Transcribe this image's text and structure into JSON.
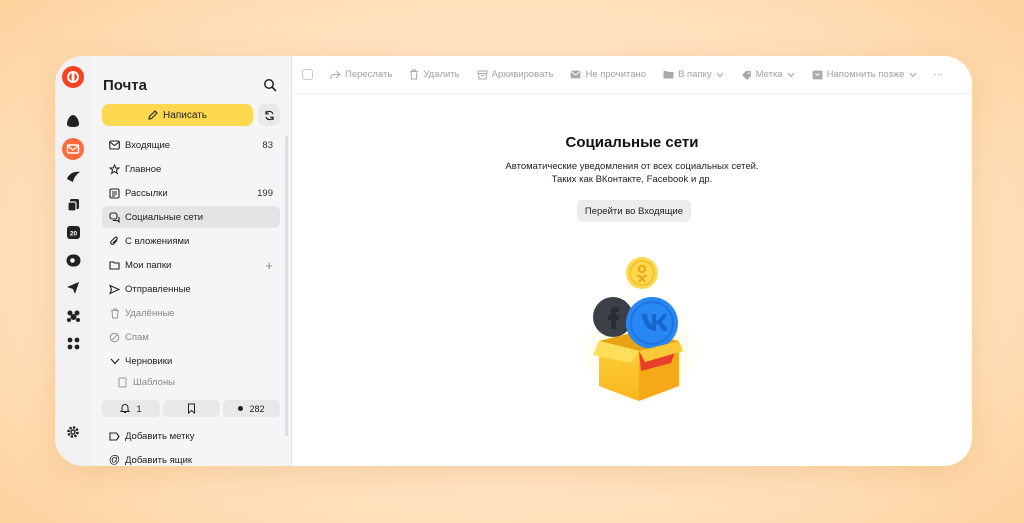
{
  "colors": {
    "accent": "#ffd84f",
    "brand": "#fc3f1d",
    "mail_icon": "#ff6a3d"
  },
  "rail": {
    "icons": [
      "yandex-id-logo-icon",
      "alice-icon",
      "mail-icon",
      "zen-icon",
      "disk-icon",
      "calendar-icon",
      "messenger-icon",
      "telemost-icon",
      "community-icon",
      "all-services-icon",
      "settings-icon"
    ],
    "calendar_day": "20"
  },
  "sidebar": {
    "title": "Почта",
    "compose_label": "Написать",
    "folders": [
      {
        "label": "Входящие",
        "count": "83",
        "icon": "inbox-icon"
      },
      {
        "label": "Главное",
        "count": "",
        "icon": "star-icon"
      },
      {
        "label": "Рассылки",
        "count": "199",
        "icon": "newsletter-icon"
      },
      {
        "label": "Социальные сети",
        "count": "",
        "icon": "chat-icon",
        "active": true
      },
      {
        "label": "С вложениями",
        "count": "",
        "icon": "paperclip-icon"
      },
      {
        "label": "Мои папки",
        "count": "+",
        "icon": "folder-icon"
      },
      {
        "label": "Отправленные",
        "count": "",
        "icon": "send-icon"
      },
      {
        "label": "Удалённые",
        "count": "",
        "icon": "trash-icon"
      },
      {
        "label": "Спам",
        "count": "",
        "icon": "spam-icon"
      },
      {
        "label": "Черновики",
        "count": "",
        "icon": "chevron-down-icon"
      },
      {
        "label": "Шаблоны",
        "count": "",
        "icon": "template-icon"
      }
    ],
    "stats": {
      "reminders": "1",
      "bookmarks": "",
      "unread": "282"
    },
    "add_label": "Добавить метку",
    "add_mailbox": "Добавить ящик"
  },
  "toolbar": {
    "forward": "Переслать",
    "delete": "Удалить",
    "archive": "Архивировать",
    "unread": "Не прочитано",
    "to_folder": "В папку",
    "label": "Метка",
    "remind": "Напомнить позже",
    "more": "···"
  },
  "empty": {
    "title": "Социальные сети",
    "desc_line1": "Автоматические уведомления от всех социальных сетей.",
    "desc_line2": "Таких как ВКонтакте, Facebook и др.",
    "button": "Перейти во Входящие"
  }
}
